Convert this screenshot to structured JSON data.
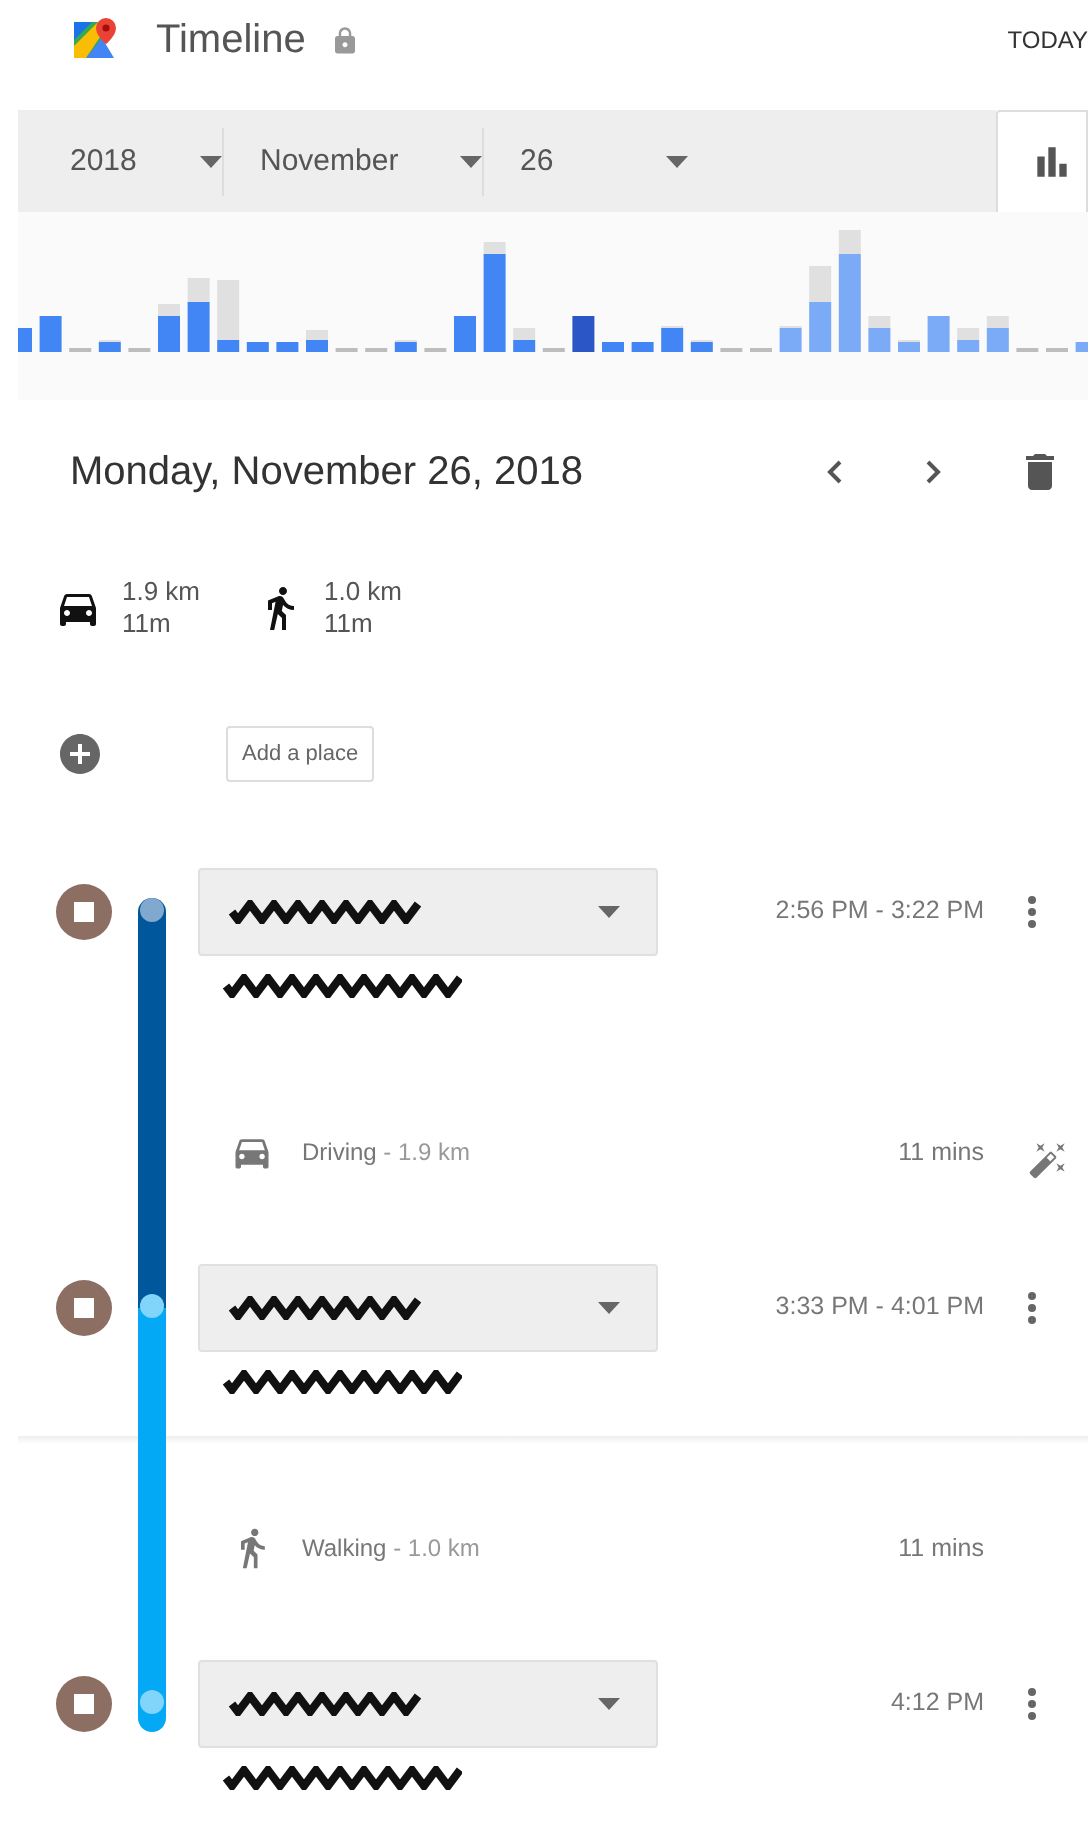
{
  "header": {
    "title": "Timeline",
    "today": "TODAY"
  },
  "date_picker": [
    {
      "kind": "year",
      "value": "2018"
    },
    {
      "kind": "month",
      "value": "November"
    },
    {
      "kind": "day",
      "value": "26"
    }
  ],
  "day": {
    "title": "Monday, November 26, 2018"
  },
  "summary": [
    {
      "kind": "car",
      "distance": "1.9 km",
      "duration": "11m"
    },
    {
      "kind": "walk",
      "distance": "1.0 km",
      "duration": "11m"
    }
  ],
  "add_place": {
    "label": "Add a place"
  },
  "timeline": [
    {
      "kind": "place",
      "time": "2:56 PM - 3:22 PM"
    },
    {
      "kind": "drive",
      "label": "Driving",
      "distance": " - 1.9 km",
      "duration": "11 mins",
      "editable": true
    },
    {
      "kind": "place",
      "time": "3:33 PM - 4:01 PM"
    },
    {
      "kind": "walk",
      "label": "Walking",
      "distance": " - 1.0 km",
      "duration": "11 mins",
      "editable": false
    },
    {
      "kind": "place",
      "time": "4:12 PM"
    }
  ]
}
